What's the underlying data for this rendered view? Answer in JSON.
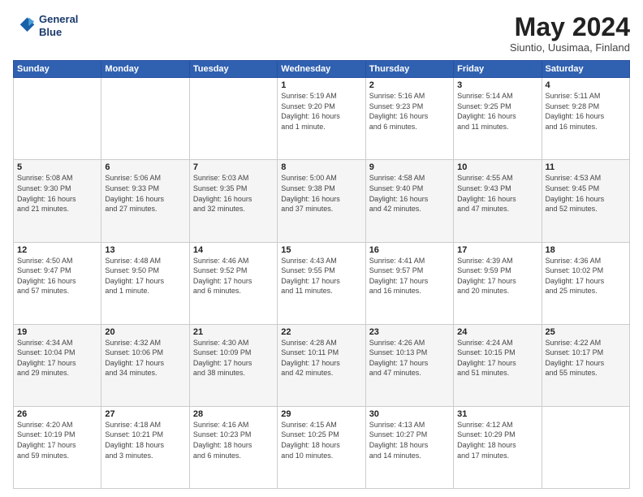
{
  "header": {
    "logo_line1": "General",
    "logo_line2": "Blue",
    "month": "May 2024",
    "location": "Siuntio, Uusimaa, Finland"
  },
  "weekdays": [
    "Sunday",
    "Monday",
    "Tuesday",
    "Wednesday",
    "Thursday",
    "Friday",
    "Saturday"
  ],
  "weeks": [
    [
      {
        "day": "",
        "info": ""
      },
      {
        "day": "",
        "info": ""
      },
      {
        "day": "",
        "info": ""
      },
      {
        "day": "1",
        "info": "Sunrise: 5:19 AM\nSunset: 9:20 PM\nDaylight: 16 hours\nand 1 minute."
      },
      {
        "day": "2",
        "info": "Sunrise: 5:16 AM\nSunset: 9:23 PM\nDaylight: 16 hours\nand 6 minutes."
      },
      {
        "day": "3",
        "info": "Sunrise: 5:14 AM\nSunset: 9:25 PM\nDaylight: 16 hours\nand 11 minutes."
      },
      {
        "day": "4",
        "info": "Sunrise: 5:11 AM\nSunset: 9:28 PM\nDaylight: 16 hours\nand 16 minutes."
      }
    ],
    [
      {
        "day": "5",
        "info": "Sunrise: 5:08 AM\nSunset: 9:30 PM\nDaylight: 16 hours\nand 21 minutes."
      },
      {
        "day": "6",
        "info": "Sunrise: 5:06 AM\nSunset: 9:33 PM\nDaylight: 16 hours\nand 27 minutes."
      },
      {
        "day": "7",
        "info": "Sunrise: 5:03 AM\nSunset: 9:35 PM\nDaylight: 16 hours\nand 32 minutes."
      },
      {
        "day": "8",
        "info": "Sunrise: 5:00 AM\nSunset: 9:38 PM\nDaylight: 16 hours\nand 37 minutes."
      },
      {
        "day": "9",
        "info": "Sunrise: 4:58 AM\nSunset: 9:40 PM\nDaylight: 16 hours\nand 42 minutes."
      },
      {
        "day": "10",
        "info": "Sunrise: 4:55 AM\nSunset: 9:43 PM\nDaylight: 16 hours\nand 47 minutes."
      },
      {
        "day": "11",
        "info": "Sunrise: 4:53 AM\nSunset: 9:45 PM\nDaylight: 16 hours\nand 52 minutes."
      }
    ],
    [
      {
        "day": "12",
        "info": "Sunrise: 4:50 AM\nSunset: 9:47 PM\nDaylight: 16 hours\nand 57 minutes."
      },
      {
        "day": "13",
        "info": "Sunrise: 4:48 AM\nSunset: 9:50 PM\nDaylight: 17 hours\nand 1 minute."
      },
      {
        "day": "14",
        "info": "Sunrise: 4:46 AM\nSunset: 9:52 PM\nDaylight: 17 hours\nand 6 minutes."
      },
      {
        "day": "15",
        "info": "Sunrise: 4:43 AM\nSunset: 9:55 PM\nDaylight: 17 hours\nand 11 minutes."
      },
      {
        "day": "16",
        "info": "Sunrise: 4:41 AM\nSunset: 9:57 PM\nDaylight: 17 hours\nand 16 minutes."
      },
      {
        "day": "17",
        "info": "Sunrise: 4:39 AM\nSunset: 9:59 PM\nDaylight: 17 hours\nand 20 minutes."
      },
      {
        "day": "18",
        "info": "Sunrise: 4:36 AM\nSunset: 10:02 PM\nDaylight: 17 hours\nand 25 minutes."
      }
    ],
    [
      {
        "day": "19",
        "info": "Sunrise: 4:34 AM\nSunset: 10:04 PM\nDaylight: 17 hours\nand 29 minutes."
      },
      {
        "day": "20",
        "info": "Sunrise: 4:32 AM\nSunset: 10:06 PM\nDaylight: 17 hours\nand 34 minutes."
      },
      {
        "day": "21",
        "info": "Sunrise: 4:30 AM\nSunset: 10:09 PM\nDaylight: 17 hours\nand 38 minutes."
      },
      {
        "day": "22",
        "info": "Sunrise: 4:28 AM\nSunset: 10:11 PM\nDaylight: 17 hours\nand 42 minutes."
      },
      {
        "day": "23",
        "info": "Sunrise: 4:26 AM\nSunset: 10:13 PM\nDaylight: 17 hours\nand 47 minutes."
      },
      {
        "day": "24",
        "info": "Sunrise: 4:24 AM\nSunset: 10:15 PM\nDaylight: 17 hours\nand 51 minutes."
      },
      {
        "day": "25",
        "info": "Sunrise: 4:22 AM\nSunset: 10:17 PM\nDaylight: 17 hours\nand 55 minutes."
      }
    ],
    [
      {
        "day": "26",
        "info": "Sunrise: 4:20 AM\nSunset: 10:19 PM\nDaylight: 17 hours\nand 59 minutes."
      },
      {
        "day": "27",
        "info": "Sunrise: 4:18 AM\nSunset: 10:21 PM\nDaylight: 18 hours\nand 3 minutes."
      },
      {
        "day": "28",
        "info": "Sunrise: 4:16 AM\nSunset: 10:23 PM\nDaylight: 18 hours\nand 6 minutes."
      },
      {
        "day": "29",
        "info": "Sunrise: 4:15 AM\nSunset: 10:25 PM\nDaylight: 18 hours\nand 10 minutes."
      },
      {
        "day": "30",
        "info": "Sunrise: 4:13 AM\nSunset: 10:27 PM\nDaylight: 18 hours\nand 14 minutes."
      },
      {
        "day": "31",
        "info": "Sunrise: 4:12 AM\nSunset: 10:29 PM\nDaylight: 18 hours\nand 17 minutes."
      },
      {
        "day": "",
        "info": ""
      }
    ]
  ]
}
